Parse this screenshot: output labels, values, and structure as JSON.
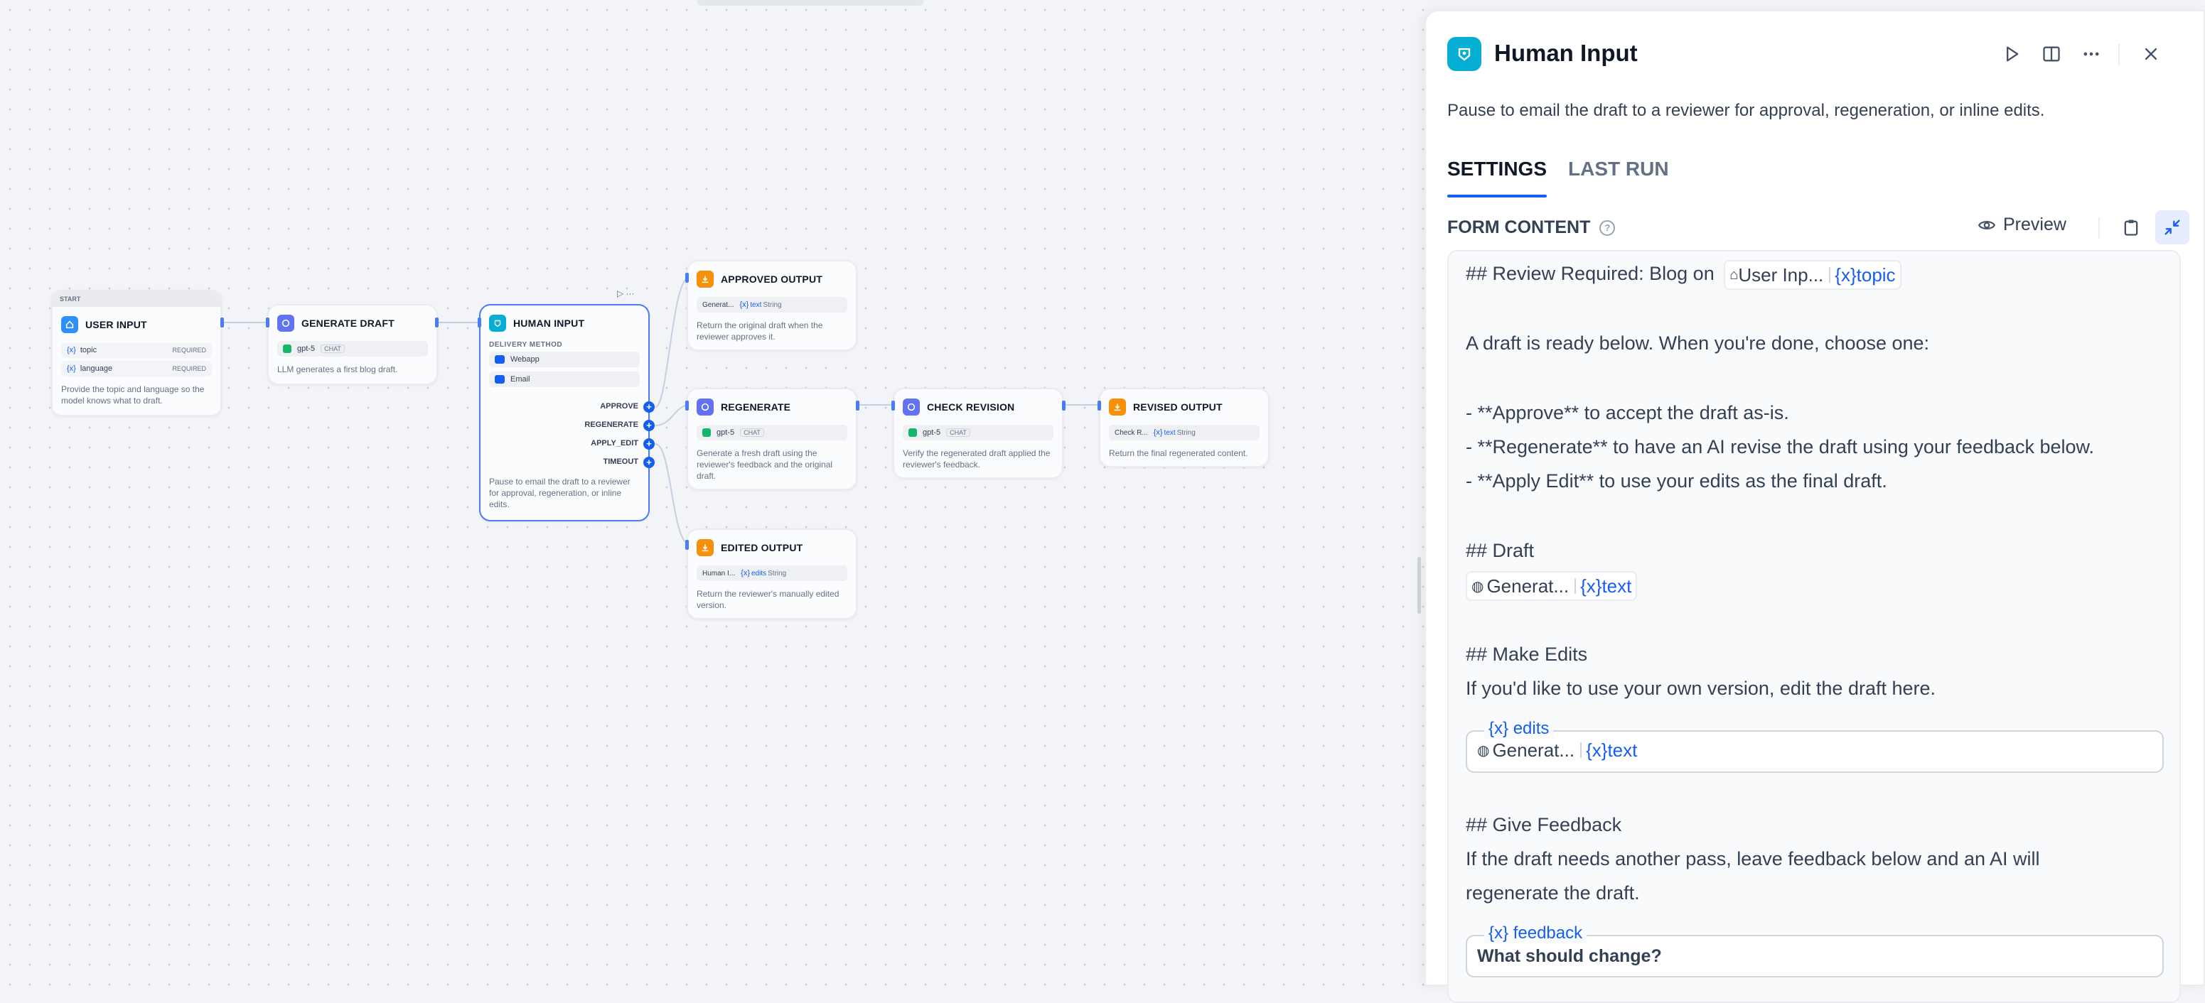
{
  "canvas": {
    "start_label": "START",
    "nodes": {
      "user_input": {
        "title": "USER INPUT",
        "desc": "Provide the topic and language so the model knows what to draft.",
        "vars": [
          {
            "name": "topic",
            "req": "REQUIRED"
          },
          {
            "name": "language",
            "req": "REQUIRED"
          }
        ]
      },
      "generate_draft": {
        "title": "GENERATE DRAFT",
        "model": "gpt-5",
        "mode": "CHAT",
        "desc": "LLM generates a first blog draft."
      },
      "human_input": {
        "title": "HUMAN INPUT",
        "delivery_label": "DELIVERY METHOD",
        "methods": [
          "Webapp",
          "Email"
        ],
        "branches": [
          "APPROVE",
          "REGENERATE",
          "APPLY_EDIT",
          "TIMEOUT"
        ],
        "desc": "Pause to email the draft to a reviewer for approval, regeneration, or inline edits."
      },
      "approved_output": {
        "title": "APPROVED OUTPUT",
        "src": "Generat...",
        "var": "text",
        "type": "String",
        "desc": "Return the original draft when the reviewer approves it."
      },
      "regenerate": {
        "title": "REGENERATE",
        "model": "gpt-5",
        "mode": "CHAT",
        "desc": "Generate a fresh draft using the reviewer's feedback and the original draft."
      },
      "check_revision": {
        "title": "CHECK REVISION",
        "model": "gpt-5",
        "mode": "CHAT",
        "desc": "Verify the regenerated draft applied the reviewer's feedback."
      },
      "revised_output": {
        "title": "REVISED OUTPUT",
        "src": "Check R...",
        "var": "text",
        "type": "String",
        "desc": "Return the final regenerated content."
      },
      "edited_output": {
        "title": "EDITED OUTPUT",
        "src": "Human I...",
        "var": "edits",
        "type": "String",
        "desc": "Return the reviewer's manually edited version."
      }
    }
  },
  "panel": {
    "title": "Human Input",
    "subtitle": "Pause to email the draft to a reviewer for approval, regeneration, or inline edits.",
    "tabs": [
      "SETTINGS",
      "LAST RUN"
    ],
    "active_tab": "SETTINGS",
    "form_label": "FORM CONTENT",
    "preview_label": "Preview",
    "editor": {
      "l1_prefix": "## Review Required: Blog on",
      "l1_chip_src": "User Inp...",
      "l1_chip_var": "topic",
      "l2": "A draft is ready below. When you're done, choose one:",
      "l3": "- **Approve** to accept the draft as-is.",
      "l4": "- **Regenerate** to have an AI revise the draft using your feedback below.",
      "l5": "- **Apply Edit** to use your edits as the final draft.",
      "h_draft": "## Draft",
      "draft_chip_src": "Generat...",
      "draft_chip_var": "text",
      "h_edits": "## Make Edits",
      "edits_text": "If you'd like to use your own version, edit the draft here.",
      "edits_field_label": "edits",
      "edits_chip_src": "Generat...",
      "edits_chip_var": "text",
      "h_feedback": "## Give Feedback",
      "feedback_text_1": "If the draft needs another pass, leave feedback below and an AI will",
      "feedback_text_2": "regenerate the draft.",
      "feedback_field_label": "feedback",
      "feedback_placeholder": "What should change?"
    }
  },
  "colors": {
    "accent": "#155eef",
    "teal": "#06aed4",
    "indigo": "#6172f3",
    "orange": "#f79009",
    "blue": "#2e90fa"
  }
}
